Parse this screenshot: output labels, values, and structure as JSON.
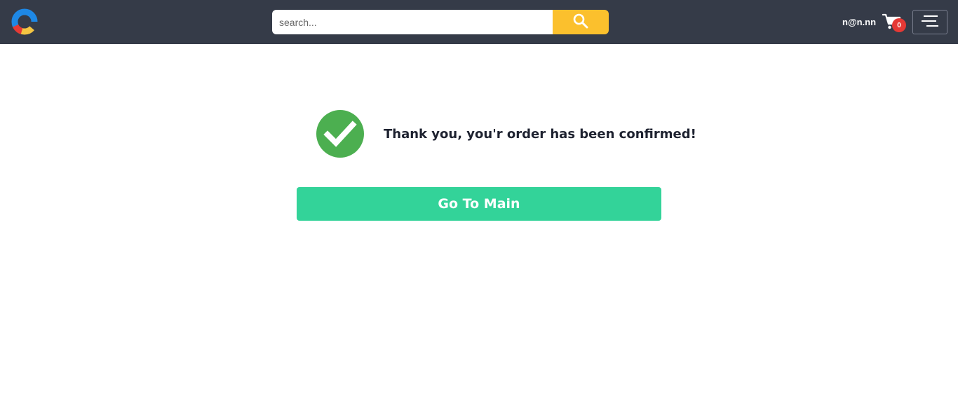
{
  "header": {
    "logo_icon": "brand-ring-logo",
    "search": {
      "placeholder": "search...",
      "value": "",
      "button_icon": "search-icon"
    },
    "user_email": "n@n.nn",
    "cart": {
      "icon": "cart-icon",
      "count": "0"
    },
    "menu_icon": "hamburger-menu-icon"
  },
  "confirmation": {
    "icon": "check-circle-icon",
    "message": "Thank you, you'r order has been confirmed!",
    "button_label": "Go To Main"
  },
  "colors": {
    "navbar_bg": "#353b48",
    "search_button": "#fbc02d",
    "cart_badge": "#e53935",
    "check_green": "#4caf50",
    "main_button": "#33d399"
  }
}
